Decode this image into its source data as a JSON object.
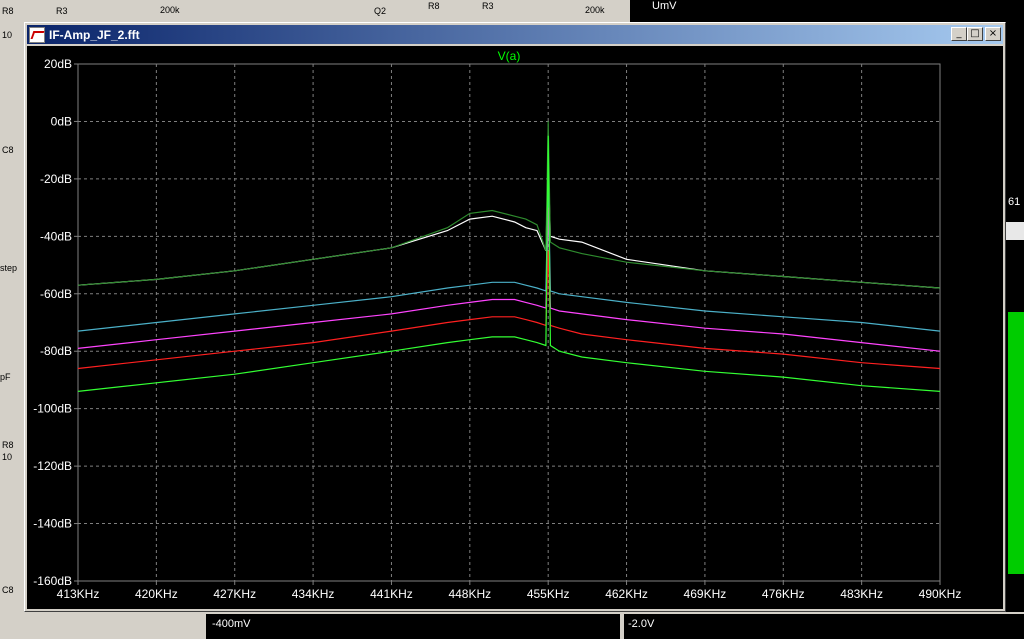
{
  "window": {
    "title": "IF-Amp_JF_2.fft",
    "buttons": {
      "minimize": "_",
      "maximize": "□",
      "close": "×"
    }
  },
  "background_fragments": {
    "r3": "R3",
    "r8": "R8",
    "r3b": "R3",
    "q2": "Q2",
    "v200k_1": "200k",
    "v200k_2": "200k",
    "umv": "UmV",
    "c8": "C8",
    "c8b": "C8",
    "step": "step",
    "pf": "pF",
    "r8b": "R8",
    "minus400mv": "-400mV",
    "minus2v": "-2.0V",
    "n61": "61",
    "n10": "10",
    "n10b": "10"
  },
  "colors": {
    "background": "#000000",
    "grid": "#7f7f7f",
    "axis_text": "#ffffff",
    "trace_label": "#00ff00"
  },
  "chart_data": {
    "type": "line",
    "title": "V(a)",
    "xlabel": "",
    "ylabel": "",
    "xlim": [
      413,
      490
    ],
    "ylim": [
      -160,
      20
    ],
    "grid": true,
    "x_ticks": [
      "413KHz",
      "420KHz",
      "427KHz",
      "434KHz",
      "441KHz",
      "448KHz",
      "455KHz",
      "462KHz",
      "469KHz",
      "476KHz",
      "483KHz",
      "490KHz"
    ],
    "x_tick_values": [
      413,
      420,
      427,
      434,
      441,
      448,
      455,
      462,
      469,
      476,
      483,
      490
    ],
    "y_ticks": [
      "20dB",
      "0dB",
      "-20dB",
      "-40dB",
      "-60dB",
      "-80dB",
      "-100dB",
      "-120dB",
      "-140dB",
      "-160dB"
    ],
    "y_tick_values": [
      20,
      0,
      -20,
      -40,
      -60,
      -80,
      -100,
      -120,
      -140,
      -160
    ],
    "series": [
      {
        "color": "#ffffff",
        "x": [
          413,
          420,
          427,
          434,
          441,
          446,
          448,
          450,
          452,
          453,
          454,
          454.8,
          455,
          455.2,
          456,
          458,
          462,
          469,
          476,
          483,
          490
        ],
        "y": [
          -57,
          -55,
          -52,
          -48,
          -44,
          -38,
          -34,
          -33,
          -35,
          -37,
          -38,
          -45,
          -15,
          -40,
          -41,
          -42,
          -48,
          -52,
          -54,
          -56,
          -58
        ]
      },
      {
        "color": "#2e8b2e",
        "x": [
          413,
          420,
          427,
          434,
          441,
          446,
          448,
          450,
          452,
          453,
          454,
          454.8,
          455,
          455.2,
          456,
          458,
          462,
          469,
          476,
          483,
          490
        ],
        "y": [
          -57,
          -55,
          -52,
          -48,
          -44,
          -37,
          -32,
          -31,
          -33,
          -34,
          -36,
          -45,
          0,
          -42,
          -44,
          -46,
          -49,
          -52,
          -54,
          -56,
          -58
        ]
      },
      {
        "color": "#4bb0c8",
        "x": [
          413,
          420,
          427,
          434,
          441,
          446,
          448,
          450,
          452,
          453,
          454,
          454.8,
          455,
          455.2,
          456,
          458,
          462,
          469,
          476,
          483,
          490
        ],
        "y": [
          -73,
          -70,
          -67,
          -64,
          -61,
          -58,
          -57,
          -56,
          -56,
          -57,
          -58,
          -59,
          -20,
          -59,
          -60,
          -61,
          -63,
          -66,
          -68,
          -70,
          -73
        ]
      },
      {
        "color": "#ff44ff",
        "x": [
          413,
          420,
          427,
          434,
          441,
          446,
          448,
          450,
          452,
          453,
          454,
          454.8,
          455,
          455.2,
          456,
          458,
          462,
          469,
          476,
          483,
          490
        ],
        "y": [
          -79,
          -76,
          -73,
          -70,
          -67,
          -64,
          -63,
          -62,
          -62,
          -63,
          -64,
          -65,
          -30,
          -65,
          -66,
          -67,
          -69,
          -72,
          -74,
          -77,
          -80
        ]
      },
      {
        "color": "#ff2020",
        "x": [
          413,
          420,
          427,
          434,
          441,
          446,
          448,
          450,
          452,
          453,
          454,
          454.8,
          455,
          455.2,
          456,
          458,
          462,
          469,
          476,
          483,
          490
        ],
        "y": [
          -86,
          -83,
          -80,
          -77,
          -73,
          -70,
          -69,
          -68,
          -68,
          -69,
          -70,
          -71,
          -45,
          -71,
          -72,
          -74,
          -76,
          -79,
          -81,
          -84,
          -86
        ]
      },
      {
        "color": "#33ff33",
        "x": [
          413,
          420,
          427,
          434,
          441,
          446,
          448,
          450,
          452,
          453,
          454,
          454.8,
          455,
          455.2,
          456,
          458,
          462,
          469,
          476,
          483,
          490
        ],
        "y": [
          -94,
          -91,
          -88,
          -84,
          -80,
          -77,
          -76,
          -75,
          -75,
          -76,
          -77,
          -78,
          -5,
          -78,
          -80,
          -82,
          -84,
          -87,
          -89,
          -92,
          -94
        ]
      }
    ]
  }
}
